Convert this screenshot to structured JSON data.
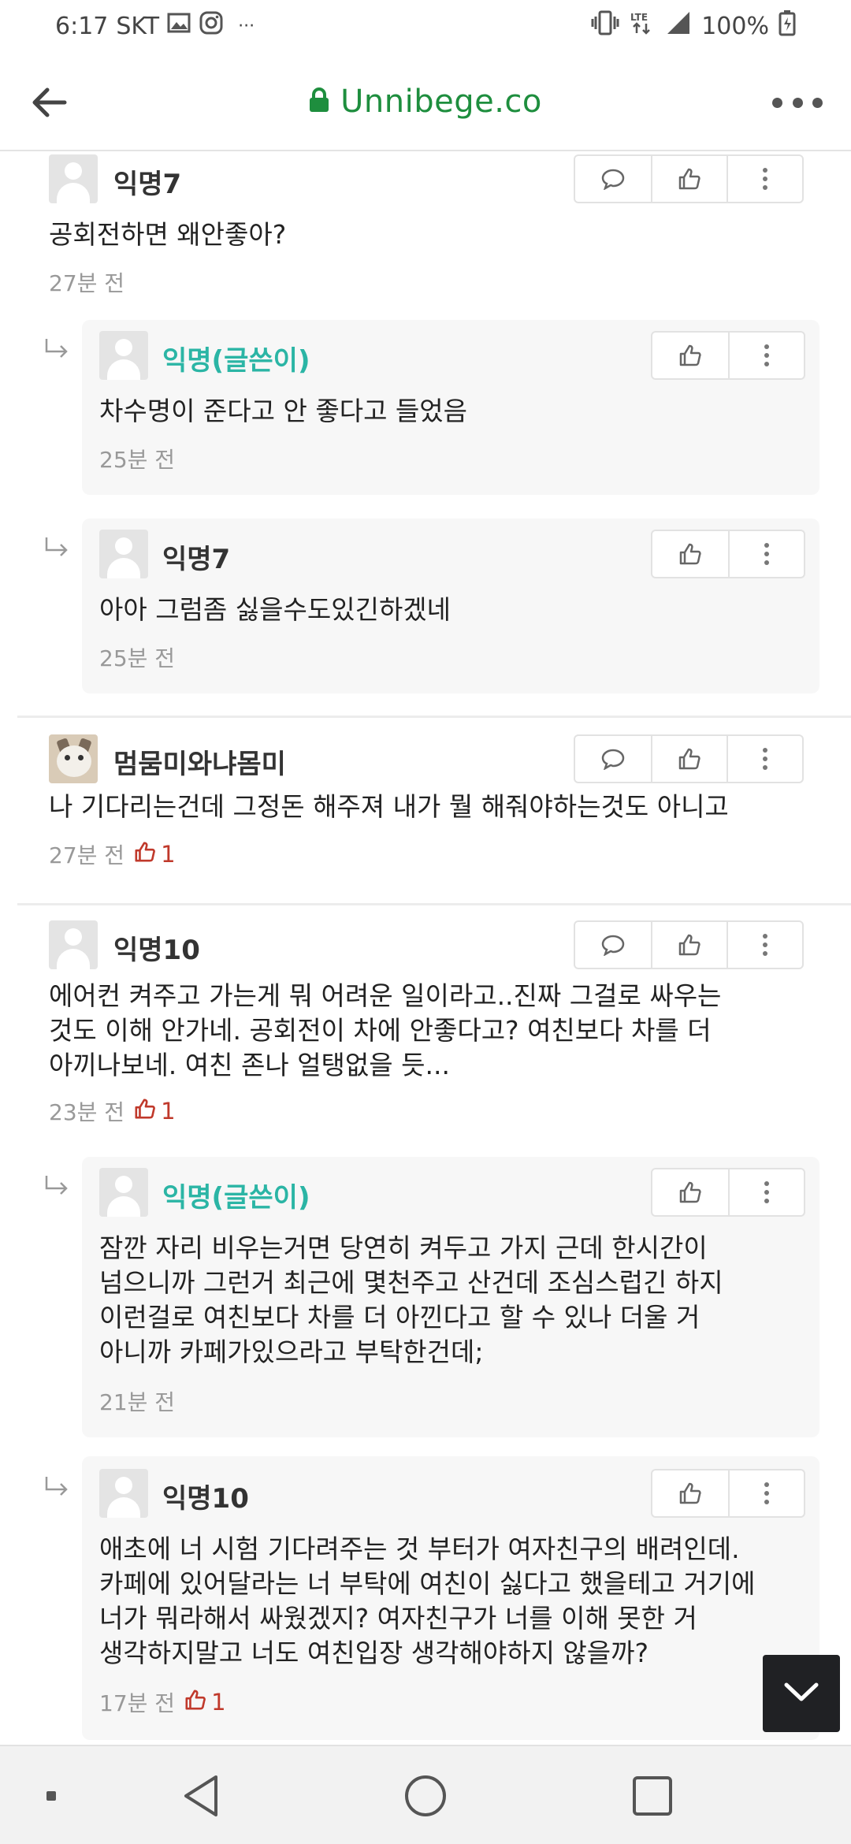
{
  "status_bar": {
    "time": "6:17",
    "carrier": "SKT",
    "battery": "100%",
    "more_indicator": "···",
    "icons": [
      "gallery-icon",
      "instagram-icon",
      "vibrate-icon",
      "lte-icon",
      "signal-icon",
      "battery-icon"
    ]
  },
  "browser": {
    "url": "Unnibege.co",
    "icons": [
      "back-arrow-icon",
      "lock-icon",
      "more-dots-icon"
    ]
  },
  "comments": [
    {
      "author": "익명7",
      "is_author": false,
      "text": "공회전하면 왜안좋아?",
      "time": "27분 전",
      "likes": null,
      "replies": [
        {
          "author": "익명(글쓴이)",
          "is_author": true,
          "text": "차수명이 준다고 안 좋다고 들었음",
          "time": "25분 전",
          "likes": null
        },
        {
          "author": "익명7",
          "is_author": false,
          "text": "아아 그럼좀 싫을수도있긴하겠네",
          "time": "25분 전",
          "likes": null
        }
      ]
    },
    {
      "author": "멈뭄미와냐몸미",
      "is_author": false,
      "text": "나 기다리는건데 그정돈 해주져 내가 뭘 해줘야하는것도 아니고",
      "time": "27분 전",
      "likes": "1",
      "replies": []
    },
    {
      "author": "익명10",
      "is_author": false,
      "text_lines": [
        "에어컨 켜주고 가는게 뭐 어려운 일이라고..진짜 그걸로 싸우는",
        "것도 이해 안가네. 공회전이 차에 안좋다고? 여친보다 차를 더",
        "아끼나보네. 여친 존나 얼탱없을 듯..."
      ],
      "time": "23분 전",
      "likes": "1",
      "replies": [
        {
          "author": "익명(글쓴이)",
          "is_author": true,
          "text_lines": [
            "잠깐 자리 비우는거면 당연히 켜두고 가지 근데 한시간이",
            "넘으니까 그런거 최근에 몇천주고 산건데 조심스럽긴 하지",
            "이런걸로 여친보다 차를 더 아낀다고 할 수 있나 더울 거",
            "아니까 카페가있으라고 부탁한건데;"
          ],
          "time": "21분 전",
          "likes": null
        },
        {
          "author": "익명10",
          "is_author": false,
          "text_lines": [
            "애초에 너 시험 기다려주는 것 부터가 여자친구의 배려인데.",
            "카페에 있어달라는 너 부탁에 여친이 싫다고 했을테고 거기에",
            "너가 뭐라해서 싸웠겠지? 여자친구가 너를 이해 못한 거",
            "생각하지말고 너도 여친입장 생각해야하지 않을까?"
          ],
          "time": "17분 전",
          "likes": "1"
        }
      ]
    }
  ],
  "icon_names": {
    "reply": "speech-bubble-icon",
    "like": "thumbs-up-icon",
    "more": "kebab-menu-icon",
    "reply_arrow": "reply-arrow-icon",
    "scroll_down": "chevron-down-icon"
  },
  "colors": {
    "author_name": "#2bb5a5",
    "url_green": "#1e8e3e",
    "like_red": "#c0392b",
    "reply_bg": "#f7f7f7"
  },
  "nav": [
    "recent-apps-dot-icon",
    "back-triangle-icon",
    "home-circle-icon",
    "overview-square-icon"
  ]
}
